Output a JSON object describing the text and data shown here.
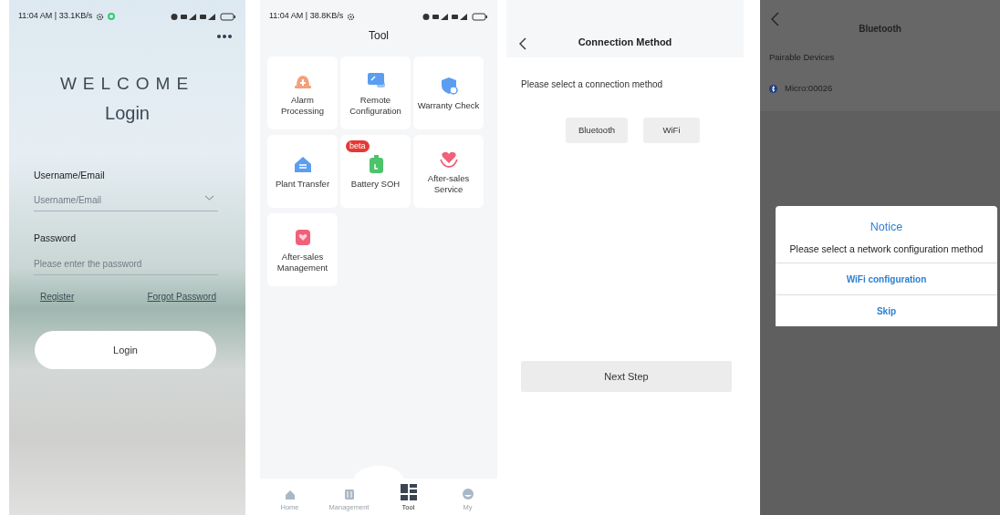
{
  "login_screen": {
    "status_bar": {
      "time": "11:04 AM | 33.1KB/s",
      "online": true
    },
    "greeting": "WELCOME",
    "title": "Login",
    "fields": [
      {
        "label": "Username/Email",
        "placeholder": "Username/Email",
        "dropdown": true
      },
      {
        "label": "Password",
        "placeholder": "Please enter the password"
      }
    ],
    "links": [
      "Register",
      "Forgot Password"
    ],
    "button": "Login"
  },
  "tool_screen": {
    "status_bar": {
      "time": "11:04 AM | 38.8KB/s"
    },
    "title": "Tool",
    "tiles": [
      {
        "label": "Alarm Processing",
        "kind": "alarm",
        "color": "#f4a07a"
      },
      {
        "label": "Remote Configuration",
        "kind": "monitor",
        "color": "#5b9ef0"
      },
      {
        "label": "Warranty Check",
        "kind": "shield",
        "color": "#5b9ef0"
      },
      {
        "label": "Plant Transfer",
        "kind": "house",
        "color": "#5b9ef0"
      },
      {
        "label": "Battery SOH",
        "kind": "battery",
        "color": "#4cc46a",
        "badge": "beta"
      },
      {
        "label": "After-sales Service",
        "kind": "heart",
        "color": "#f0607a"
      },
      {
        "label": "After-sales Management",
        "kind": "heartbox",
        "color": "#f0607a"
      }
    ],
    "nav": [
      {
        "label": "Home",
        "kind": "home",
        "selected": false
      },
      {
        "label": "Management",
        "kind": "manage",
        "selected": false
      },
      {
        "label": "Tool",
        "kind": "tool",
        "selected": true
      },
      {
        "label": "My",
        "kind": "my",
        "selected": false
      }
    ]
  },
  "connection_screen": {
    "title": "Connection Method",
    "prompt": "Please select a connection method",
    "options": [
      {
        "label": "Bluetooth"
      },
      {
        "label": "WiFi"
      }
    ],
    "next_button": "Next Step"
  },
  "bluetooth_screen": {
    "title": "Bluetooth",
    "section": "Pairable Devices",
    "devices": [
      {
        "name": "Micro:00026"
      }
    ],
    "dialog": {
      "title": "Notice",
      "message": "Please select a network configuration method",
      "actions": [
        "WiFi configuration",
        "Skip"
      ]
    }
  }
}
